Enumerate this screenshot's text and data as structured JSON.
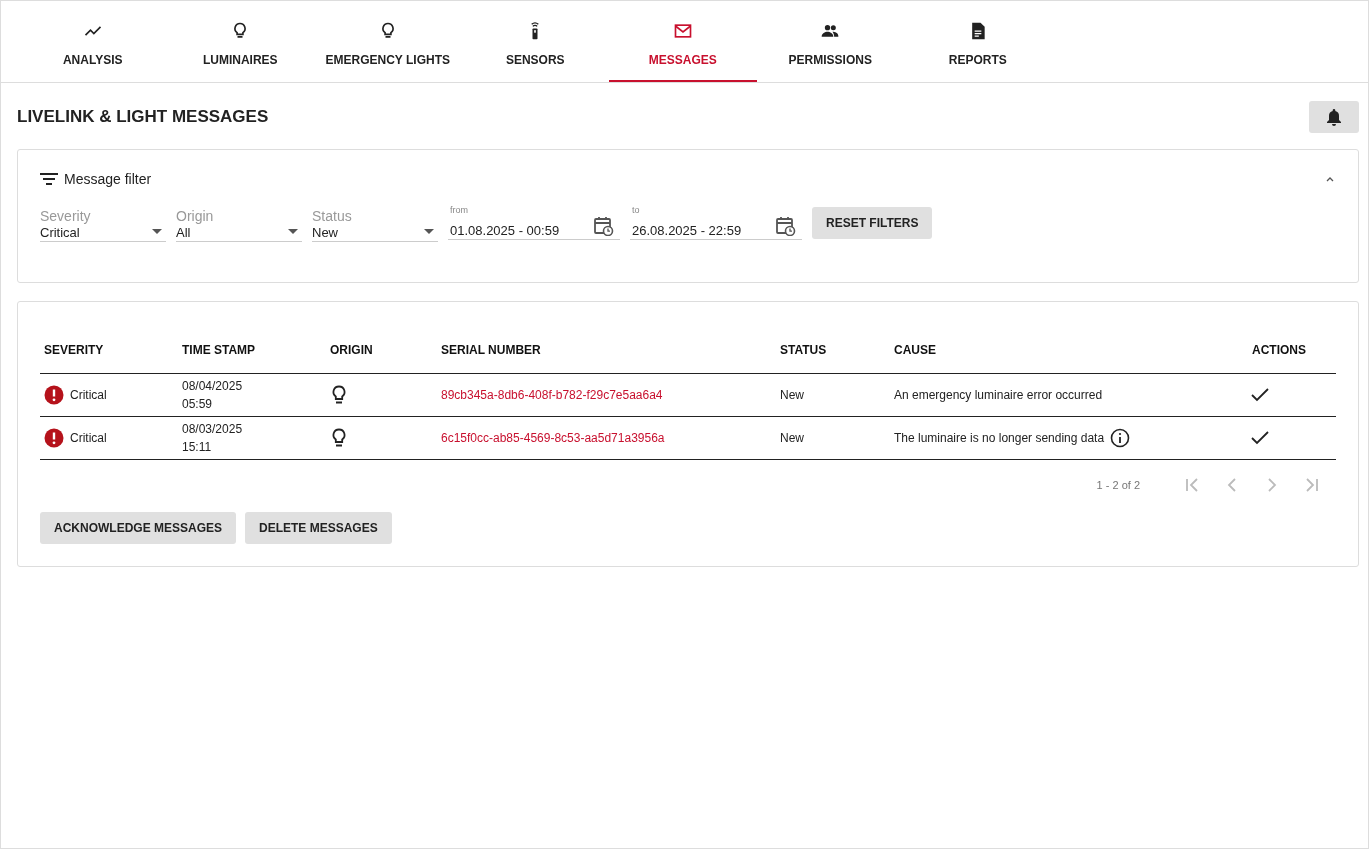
{
  "tabs": [
    {
      "label": "ANALYSIS",
      "selected": false
    },
    {
      "label": "LUMINAIRES",
      "selected": false
    },
    {
      "label": "EMERGENCY LIGHTS",
      "selected": false
    },
    {
      "label": "SENSORS",
      "selected": false
    },
    {
      "label": "MESSAGES",
      "selected": true
    },
    {
      "label": "PERMISSIONS",
      "selected": false
    },
    {
      "label": "REPORTS",
      "selected": false
    }
  ],
  "page_title": "LIVELINK & LIGHT MESSAGES",
  "filter": {
    "title": "Message filter",
    "expanded": true,
    "selects": [
      {
        "label": "Severity",
        "value": "Critical"
      },
      {
        "label": "Origin",
        "value": "All"
      },
      {
        "label": "Status",
        "value": "New"
      }
    ],
    "dates": [
      {
        "label": "from",
        "value": "01.08.2025 - 00:59"
      },
      {
        "label": "to",
        "value": "26.08.2025 - 22:59"
      }
    ],
    "reset_button": "RESET FILTERS"
  },
  "table": {
    "columns": [
      "SEVERITY",
      "TIME STAMP",
      "ORIGIN",
      "SERIAL NUMBER",
      "STATUS",
      "CAUSE",
      "ACTIONS"
    ],
    "rows": [
      {
        "severity": "Critical",
        "kind": "critical",
        "date": "08/04/2025",
        "time": "05:59",
        "serial": "89cb345a-8db6-408f-b782-f29c7e5aa6a4",
        "status": "New",
        "cause": "An emergency luminaire error occurred",
        "info": false
      },
      {
        "severity": "Critical",
        "kind": "critical",
        "date": "08/03/2025",
        "time": "15:11",
        "serial": "6c15f0cc-ab85-4569-8c53-aa5d71a3956a",
        "status": "New",
        "cause": "The luminaire is no longer sending data",
        "info": true
      }
    ],
    "range": "1 - 2 of 2",
    "pager": [
      {
        "disabled": true
      },
      {
        "disabled": true
      },
      {
        "disabled": true
      },
      {
        "disabled": true
      }
    ]
  },
  "buttons": [
    "ACKNOWLEDGE MESSAGES",
    "DELETE MESSAGES"
  ]
}
